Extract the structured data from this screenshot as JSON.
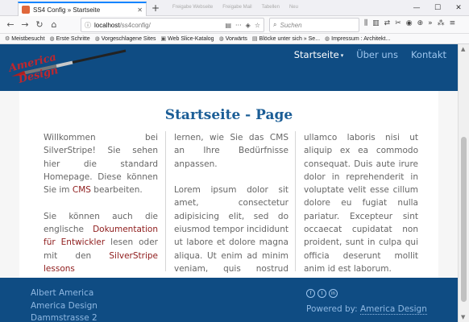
{
  "browser": {
    "tab_title": "SS4 Config » Startseite",
    "tab_close": "✕",
    "new_tab": "+",
    "ghost_tabs": [
      "Freigabe Webseite",
      "Freigabe Mail",
      "Tabellen",
      "Neu"
    ],
    "window_controls": [
      "—",
      "☐",
      "✕"
    ],
    "url_host": "localhost",
    "url_path": "/ss4config/",
    "search_placeholder": "Suchen",
    "url_more": "···",
    "bookmarks": [
      {
        "icon": "gear-icon",
        "glyph": "⚙",
        "label": "Meistbesucht"
      },
      {
        "icon": "globe-icon",
        "glyph": "◍",
        "label": "Erste Schritte"
      },
      {
        "icon": "globe-icon",
        "glyph": "◍",
        "label": "Vorgeschlagene Sites"
      },
      {
        "icon": "webslice-icon",
        "glyph": "▣",
        "label": "Web Slice-Katalog"
      },
      {
        "icon": "globe-icon",
        "glyph": "◍",
        "label": "Vorwärts"
      },
      {
        "icon": "page-icon",
        "glyph": "▤",
        "label": "Blöcke unter sich » Se..."
      },
      {
        "icon": "globe-icon",
        "glyph": "◍",
        "label": "Impressum : Architekt..."
      }
    ]
  },
  "site": {
    "nav": [
      {
        "label": "Startseite",
        "active": true
      },
      {
        "label": "Über uns",
        "active": false
      },
      {
        "label": "Kontakt",
        "active": false
      }
    ],
    "logo_text": [
      "America",
      "Design"
    ],
    "page_title": "Startseite - Page",
    "col1": {
      "p1_text": "Willkommen bei SilverStripe! Sie sehen hier die standard Homepage. Diese können Sie im ",
      "p1_link": "CMS",
      "p1_end": " bearbeiten.",
      "p2_text": "Sie können auch die englische ",
      "p2_link1": "Dokumentation für Entwickler",
      "p2_mid": " lesen oder mit den ",
      "p2_link2": "SilverStripe lessons"
    },
    "col2": {
      "p1": "lernen, wie Sie das CMS an Ihre Bedürfnisse anpassen.",
      "p2": "Lorem ipsum dolor sit amet, consectetur adipisicing elit, sed do eiusmod tempor incididunt ut labore et dolore magna aliqua. Ut enim ad minim veniam, quis nostrud exercitation"
    },
    "col3": {
      "p1": "ullamco laboris nisi ut aliquip ex ea commodo consequat. Duis aute irure dolor in reprehenderit in voluptate velit esse cillum dolore eu fugiat nulla pariatur. Excepteur sint occaecat cupidatat non proident, sunt in culpa qui officia deserunt mollit anim id est laborum."
    },
    "footer": {
      "address": [
        "Albert America",
        "America Design",
        "Dammstrasse 2"
      ],
      "social": [
        "f",
        "t",
        "in"
      ],
      "powered_prefix": "Powered by: ",
      "powered_link": "America Design"
    }
  },
  "colors": {
    "brand_blue": "#0f4c83",
    "link_red": "#8e1b1b",
    "title_blue": "#1a5d96"
  }
}
